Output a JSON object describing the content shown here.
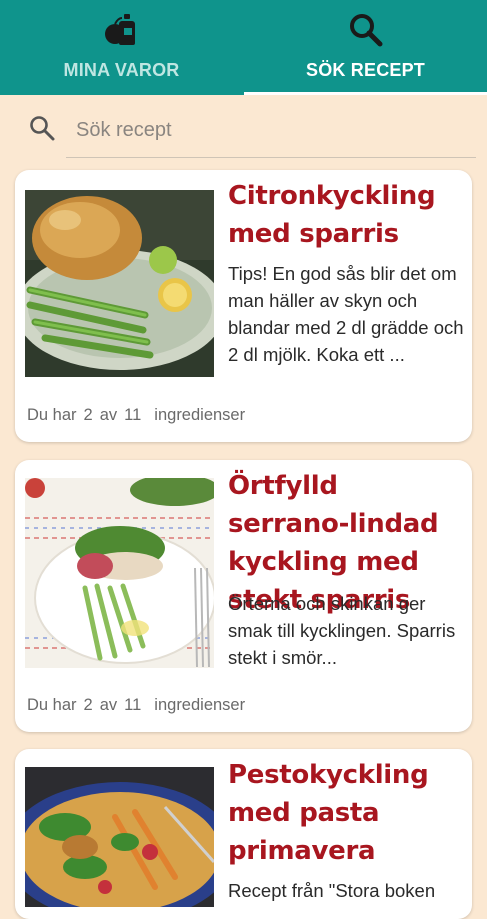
{
  "tabs": [
    {
      "label": "MINA VAROR",
      "icon": "groceries-icon",
      "selected": false
    },
    {
      "label": "SÖK RECEPT",
      "icon": "search-icon",
      "selected": true
    }
  ],
  "search": {
    "placeholder": "Sök recept",
    "value": ""
  },
  "colors": {
    "teal": "#0f948c",
    "title_red": "#a8161f",
    "background": "#fbe8d2"
  },
  "recipes": [
    {
      "title": "Citronkyckling med sparris",
      "description": "Tips! En god sås blir det om man häller av skyn och blandar med 2 dl grädde och 2 dl mjölk. Koka ett ...",
      "footer": {
        "prefix": "Du har",
        "have": "2",
        "of": "av",
        "total": "11",
        "suffix": "ingredienser"
      }
    },
    {
      "title": "Örtfylld serrano-lindad kyckling med stekt sparris",
      "description": "Örterna och skinkan ger smak till kycklingen. Sparris stekt i smör...",
      "footer": {
        "prefix": "Du har",
        "have": "2",
        "of": "av",
        "total": "11",
        "suffix": "ingredienser"
      }
    },
    {
      "title": "Pestokyckling med pasta primavera",
      "description": "Recept från \"Stora boken"
    }
  ]
}
